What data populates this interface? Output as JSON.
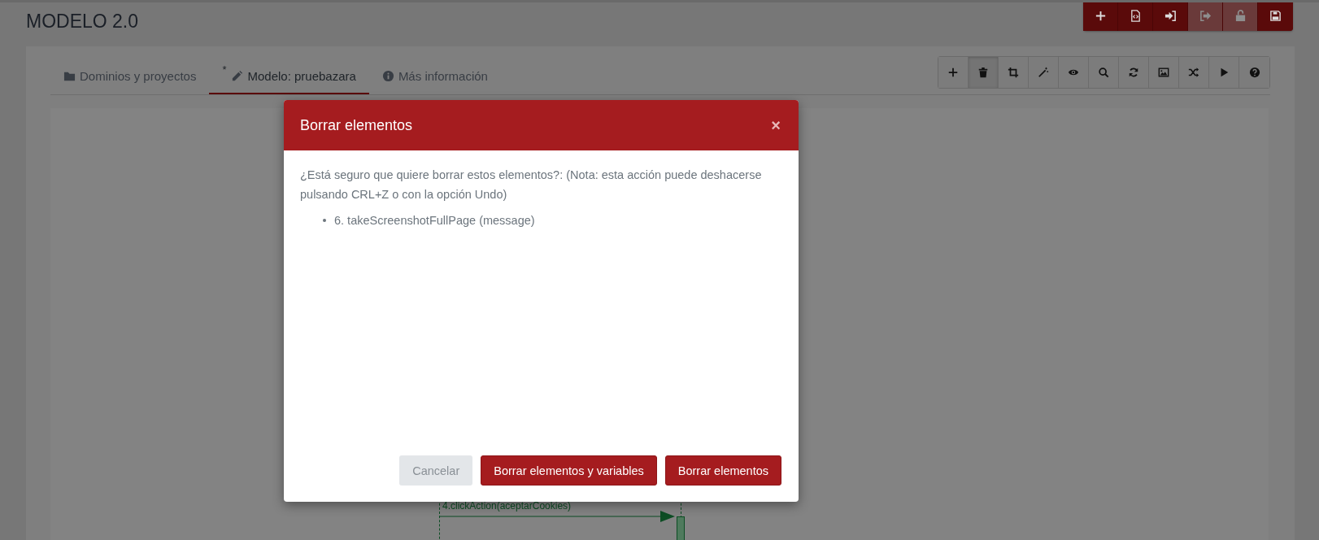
{
  "page": {
    "title": "MODELO 2.0"
  },
  "top_actions": [
    {
      "kind": "plus",
      "disabled": false
    },
    {
      "kind": "file-code",
      "disabled": false
    },
    {
      "kind": "sign-in",
      "disabled": false
    },
    {
      "kind": "sign-out",
      "disabled": true
    },
    {
      "kind": "unlock",
      "disabled": true
    },
    {
      "kind": "save",
      "disabled": false
    }
  ],
  "tabs": [
    {
      "kind": "folder",
      "label": "Dominios y proyectos",
      "selected": false
    },
    {
      "kind": "pencil",
      "label": "Modelo: pruebazara",
      "modified_mark": "*",
      "selected": true
    },
    {
      "kind": "info",
      "label": "Más información",
      "selected": false
    }
  ],
  "toolbar": [
    {
      "kind": "plus",
      "selected": false
    },
    {
      "kind": "trash",
      "selected": true
    },
    {
      "kind": "crop",
      "selected": false
    },
    {
      "kind": "magic",
      "selected": false
    },
    {
      "kind": "eye",
      "selected": false
    },
    {
      "kind": "search",
      "selected": false
    },
    {
      "kind": "refresh",
      "selected": false
    },
    {
      "kind": "image",
      "selected": false
    },
    {
      "kind": "shuffle",
      "selected": false
    },
    {
      "kind": "play",
      "selected": false
    },
    {
      "kind": "question",
      "selected": false
    }
  ],
  "diagram": {
    "message": "4.clickAction(aceptarCookies)"
  },
  "dialog": {
    "title": "Borrar elementos",
    "close": "×",
    "message": "¿Está seguro que quiere borrar estos elementos?: (Nota: esta acción puede deshacerse pulsando CRL+Z o con la opción Undo)",
    "items": [
      "6. takeScreenshotFullPage (message)"
    ],
    "buttons": [
      {
        "label": "Cancelar",
        "kind": "secondary"
      },
      {
        "label": "Borrar elementos y variables",
        "kind": "primary"
      },
      {
        "label": "Borrar elementos",
        "kind": "primary"
      }
    ]
  }
}
